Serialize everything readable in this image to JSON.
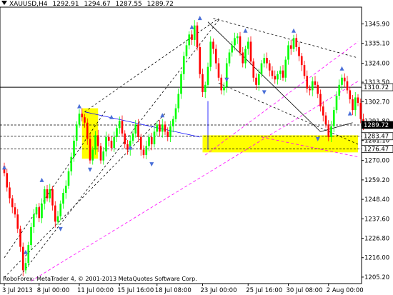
{
  "header": {
    "symbol": "XAUUSD,H4",
    "open": "1292.91",
    "high": "1294.67",
    "low": "1287.55",
    "close": "1289.72"
  },
  "footer": {
    "copyright": "RoboForex: MetaTrader 4, © 2001-2013 MetaQuotes Software Corp."
  },
  "colors": {
    "background": "#ffffff",
    "bull_candle": "#00ff00",
    "bear_candle": "#ff0000",
    "target_zone": "#ffff00",
    "fractal_arrow": "#4a6fd8",
    "trend_line": "#000000",
    "channel_line": "#ff00ff",
    "triangle_line": "#0000ff"
  },
  "chart_data": {
    "type": "candlestick",
    "title": "XAUUSD,H4",
    "ylim": [
      1201.6,
      1355.2
    ],
    "y_ticks": [
      "1345.90",
      "1335.10",
      "1324.00",
      "1313.50",
      "1302.70",
      "1291.80",
      "1281.10",
      "1270.00",
      "1259.20",
      "1248.40",
      "1237.60",
      "1226.80",
      "1216.00",
      "1205.20"
    ],
    "x_ticks": [
      "3 Jul 2013",
      "8 Jul 00:00",
      "11 Jul 00:00",
      "15 Jul 16:00",
      "18 Jul 08:00",
      "23 Jul 00:00",
      "25 Jul 16:00",
      "30 Jul 08:00",
      "2 Aug 00:00"
    ],
    "price_labels": [
      {
        "text": "1310.72",
        "value": 1310.72,
        "style": "level"
      },
      {
        "text": "1289.72",
        "value": 1289.72,
        "style": "current"
      },
      {
        "text": "1283.47",
        "value": 1283.47,
        "style": "level"
      },
      {
        "text": "1276.47",
        "value": 1276.47,
        "style": "level"
      }
    ],
    "target_zones": [
      {
        "from_bar": 29,
        "to_bar": 35,
        "low": 1271.0,
        "high": 1299.0
      },
      {
        "from_bar": 74,
        "to_bar": 132,
        "low": 1274.5,
        "high": 1284.0
      }
    ],
    "closes": [
      1263.0,
      1255.0,
      1249.0,
      1244.0,
      1240.0,
      1232.0,
      1222.0,
      1209.0,
      1213.0,
      1223.0,
      1233.0,
      1240.0,
      1244.0,
      1238.0,
      1246.0,
      1254.0,
      1249.0,
      1254.0,
      1245.0,
      1236.0,
      1239.0,
      1246.0,
      1252.0,
      1256.0,
      1264.0,
      1272.0,
      1281.0,
      1290.0,
      1296.0,
      1294.0,
      1291.0,
      1282.0,
      1270.0,
      1276.0,
      1284.0,
      1278.0,
      1270.0,
      1275.0,
      1283.0,
      1281.0,
      1277.0,
      1283.0,
      1288.0,
      1292.0,
      1285.0,
      1279.0,
      1276.0,
      1281.0,
      1285.0,
      1290.0,
      1283.0,
      1276.0,
      1273.0,
      1278.0,
      1283.0,
      1279.0,
      1286.0,
      1290.0,
      1286.0,
      1290.0,
      1286.0,
      1283.0,
      1289.0,
      1293.0,
      1299.0,
      1307.0,
      1318.0,
      1328.0,
      1334.0,
      1340.0,
      1337.0,
      1345.0,
      1333.0,
      1318.0,
      1308.0,
      1312.0,
      1322.0,
      1336.0,
      1332.0,
      1324.0,
      1316.0,
      1309.0,
      1311.0,
      1324.0,
      1330.0,
      1334.0,
      1338.0,
      1339.0,
      1330.0,
      1324.0,
      1332.0,
      1336.0,
      1325.0,
      1316.0,
      1312.0,
      1318.0,
      1324.0,
      1327.0,
      1324.0,
      1320.0,
      1317.0,
      1315.0,
      1318.0,
      1320.0,
      1316.0,
      1326.0,
      1334.0,
      1332.0,
      1338.0,
      1333.0,
      1328.0,
      1323.0,
      1317.0,
      1310.0,
      1309.0,
      1314.0,
      1312.0,
      1307.0,
      1300.0,
      1295.0,
      1290.0,
      1283.0,
      1289.0,
      1298.0,
      1306.0,
      1312.0,
      1316.0,
      1314.0,
      1309.0,
      1304.0,
      1298.0,
      1305.0,
      1302.0,
      1293.0,
      1289.72
    ]
  }
}
